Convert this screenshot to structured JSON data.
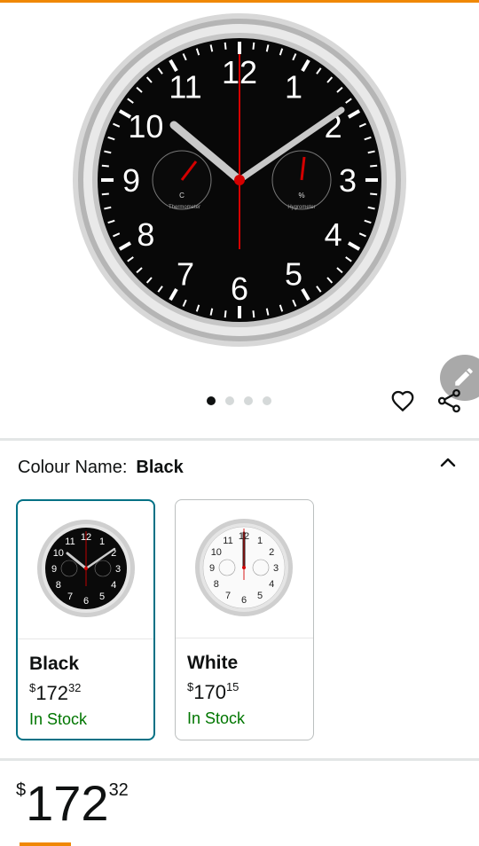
{
  "product": {
    "image_dots": 4,
    "active_image": 0,
    "hero_clock": {
      "numerals": [
        "12",
        "1",
        "2",
        "3",
        "4",
        "5",
        "6",
        "7",
        "8",
        "9",
        "10",
        "11"
      ],
      "thermometer_label": "Thermometer",
      "thermometer_unit": "C",
      "hygrometer_label": "Hygrometer",
      "hygrometer_unit": "%"
    }
  },
  "icons": {
    "heart": "heart-icon",
    "share": "share-icon",
    "edit": "pencil-icon",
    "collapse": "chevron-up-icon"
  },
  "colour": {
    "label": "Colour Name:",
    "selected": "Black"
  },
  "swatches": [
    {
      "name": "Black",
      "currency": "$",
      "price_whole": "172",
      "price_fraction": "32",
      "stock": "In Stock"
    },
    {
      "name": "White",
      "currency": "$",
      "price_whole": "170",
      "price_fraction": "15",
      "stock": "In Stock"
    }
  ],
  "price": {
    "currency": "$",
    "whole": "172",
    "fraction": "32"
  },
  "colors": {
    "accent": "#f08804",
    "selected_border": "#007185",
    "in_stock": "#007600",
    "clock_hand": "#d40000"
  }
}
